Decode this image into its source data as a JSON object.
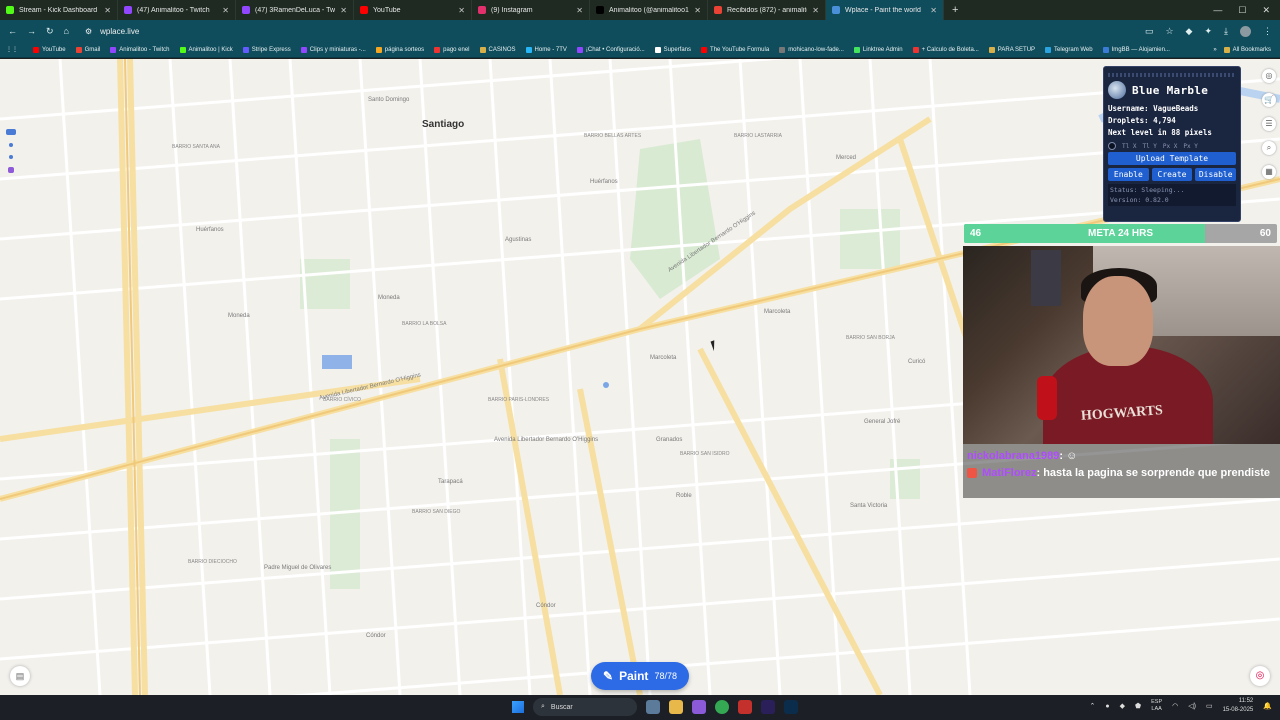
{
  "browser": {
    "tabs": [
      {
        "label": "Stream - Kick Dashboard",
        "color": "#53fc18"
      },
      {
        "label": "(47) Animalitoo - Twitch",
        "color": "#9146ff"
      },
      {
        "label": "(47) 3RamenDeLuca - Twitch",
        "color": "#9146ff"
      },
      {
        "label": "YouTube",
        "color": "#ff0000"
      },
      {
        "label": "(9) Instagram",
        "color": "#e1306c"
      },
      {
        "label": "Animalitoo (@animalitoo1) | Ti",
        "color": "#000000"
      },
      {
        "label": "Recibidos (872) - animalitoo.st",
        "color": "#ea4335"
      },
      {
        "label": "Wplace - Paint the world",
        "color": "#4a90d9"
      }
    ],
    "new_tab": "+",
    "url": "wplace.live",
    "bookmarks": [
      {
        "label": "YouTube",
        "color": "#ff0000"
      },
      {
        "label": "Gmail",
        "color": "#ea4335"
      },
      {
        "label": "Animalitoo - Twitch",
        "color": "#9146ff"
      },
      {
        "label": "Animalitoo | Kick",
        "color": "#53fc18"
      },
      {
        "label": "Stripe Express",
        "color": "#635bff"
      },
      {
        "label": "Clips y miniaturas -...",
        "color": "#9146ff"
      },
      {
        "label": "página sorteos",
        "color": "#f5a623"
      },
      {
        "label": "pago enel",
        "color": "#e33"
      },
      {
        "label": "CASINOS",
        "color": "#d8b04a"
      },
      {
        "label": "Home - 7TV",
        "color": "#29b6f6"
      },
      {
        "label": "¡Chat • Configuració...",
        "color": "#9146ff"
      },
      {
        "label": "Superfans",
        "color": "#ffffff"
      },
      {
        "label": "The YouTube Formula",
        "color": "#ff0000"
      },
      {
        "label": "mohicano-low-fade...",
        "color": "#777777"
      },
      {
        "label": "Linktree Admin",
        "color": "#43e55e"
      },
      {
        "label": "+ Calculo de Boleta...",
        "color": "#e33"
      },
      {
        "label": "PARA SETUP",
        "color": "#d8b04a"
      },
      {
        "label": "Telegram Web",
        "color": "#2aa3e0"
      },
      {
        "label": "ImgBB — Alojamien...",
        "color": "#3a7bd5"
      }
    ],
    "all_bookmarks": "All Bookmarks"
  },
  "map": {
    "city_label": "Santiago",
    "labels": {
      "santo_domingo": "Santo Domingo",
      "barrio_santa_ana": "BARRIO SANTA ANA",
      "barrio_bellas_artes": "BARRIO BELLAS ARTES",
      "barrio_lastarria": "BARRIO LASTARRIA",
      "barrio_la_bolsa": "BARRIO LA BOLSA",
      "barrio_civico": "BARRIO CÍVICO",
      "barrio_paris_londres": "BARRIO PARIS-LONDRES",
      "barrio_san_borja": "BARRIO SAN BORJA",
      "barrio_san_isidro": "BARRIO SAN ISIDRO",
      "barrio_san_diego": "BARRIO SAN DIEGO",
      "barrio_dieciocho": "BARRIO DIECIOCHO",
      "huerfanos": "Huérfanos",
      "agustinas": "Agustinas",
      "moneda": "Moneda",
      "marcoleta": "Marcoleta",
      "granados": "Granados",
      "tarapaca": "Tarapacá",
      "alameda": "Avenida Libertador Bernardo O'Higgins",
      "santa_victoria": "Santa Victoria",
      "condor": "Cóndor",
      "padre_miguel": "Padre Miguel de Olivares",
      "roble": "Roble",
      "general_jofre": "General Jofré",
      "curico": "Curicó",
      "merced": "Merced"
    }
  },
  "blue_marble": {
    "title": "Blue Marble",
    "username_line": "Username: VagueBeads",
    "droplets_line": "Droplets: 4,794",
    "next_level_line": "Next level in 88 pixels",
    "coords": [
      "Tl X",
      "Tl Y",
      "Px X",
      "Px Y"
    ],
    "upload_label": "Upload Template",
    "enable_label": "Enable",
    "create_label": "Create",
    "disable_label": "Disable",
    "status_line": "Status: Sleeping...",
    "version_line": "Version: 0.82.0"
  },
  "goal_bar": {
    "current": "46",
    "label": "META 24 HRS",
    "target": "60",
    "progress": 0.77
  },
  "chat": {
    "msg1_user": "nickolabrana1989",
    "msg2_user": "MatiFlorez",
    "msg2_text": "hasta la pagina se sorprende que prendiste"
  },
  "webcam": {
    "hoodie_text": "HOGWARTS"
  },
  "paint": {
    "label": "Paint",
    "count": "78/78"
  },
  "taskbar": {
    "search_placeholder": "Buscar",
    "lang_line1": "ESP",
    "lang_line2": "LAA",
    "time": "11:52",
    "date": "15-08-2025"
  }
}
